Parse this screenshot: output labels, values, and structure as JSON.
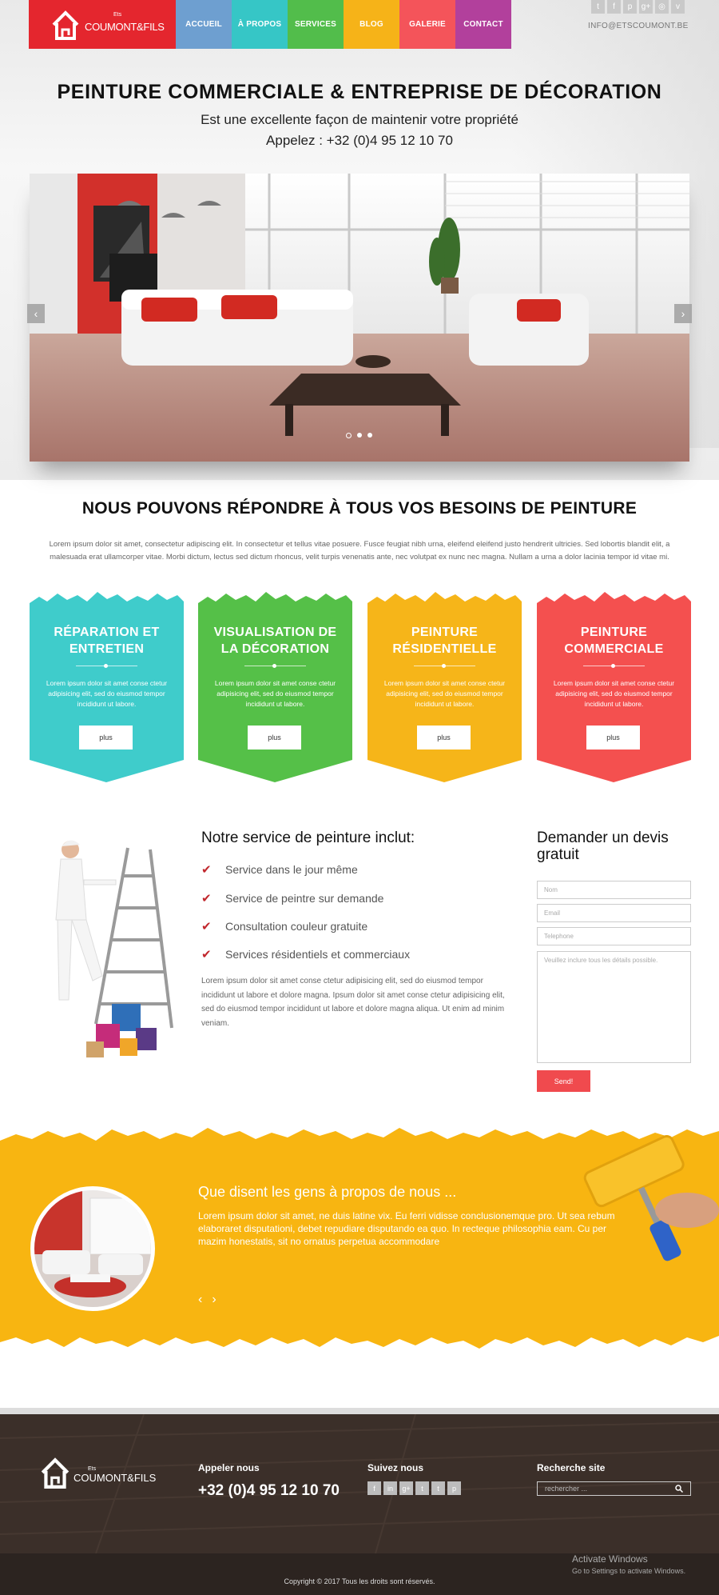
{
  "header": {
    "logo_small": "Ets",
    "logo_brand": "COUMONT&FILS",
    "nav": [
      {
        "label": "ACCUEIL",
        "color": "#6e9fd0"
      },
      {
        "label": "À PROPOS",
        "color": "#36c6c6"
      },
      {
        "label": "SERVICES",
        "color": "#52bd4b"
      },
      {
        "label": "BLOG",
        "color": "#f6b318"
      },
      {
        "label": "GALERIE",
        "color": "#f4545a"
      },
      {
        "label": "CONTACT",
        "color": "#b2409c"
      }
    ],
    "social_icons": [
      "twitter-icon",
      "facebook-icon",
      "pinterest-icon",
      "google-plus-icon",
      "instagram-icon",
      "vimeo-icon"
    ],
    "email": "INFO@ETSCOUMONT.BE"
  },
  "hero": {
    "title": "PEINTURE COMMERCIALE & ENTREPRISE DE DÉCORATION",
    "subtitle": "Est une excellente façon de maintenir votre propriété",
    "phone": "Appelez : +32 (0)4 95 12 10 70"
  },
  "slider": {
    "prev": "‹",
    "next": "›",
    "slide_count": 3,
    "active_slide": 1
  },
  "needs": {
    "title": "NOUS POUVONS RÉPONDRE À TOUS VOS BESOINS DE PEINTURE",
    "text": "Lorem ipsum dolor sit amet, consectetur adipiscing elit. In consectetur et tellus vitae posuere. Fusce feugiat nibh urna, eleifend eleifend justo hendrerit ultricies. Sed lobortis blandit elit, a malesuada erat ullamcorper vitae. Morbi dictum, lectus sed dictum rhoncus, velit turpis venenatis ante, nec volutpat ex nunc nec magna. Nullam a urna a dolor lacinia tempor id vitae mi.",
    "cards": [
      {
        "title": "RÉPARATION ET ENTRETIEN",
        "text": "Lorem ipsum dolor sit amet conse ctetur adipisicing elit, sed do eiusmod tempor incididunt ut labore.",
        "button": "plus",
        "color": "#3fcccb"
      },
      {
        "title": "VISUALISATION DE LA DÉCORATION",
        "text": "Lorem ipsum dolor sit amet conse ctetur adipisicing elit, sed do eiusmod tempor incididunt ut labore.",
        "button": "plus",
        "color": "#55c048"
      },
      {
        "title": "PEINTURE RÉSIDENTIELLE",
        "text": "Lorem ipsum dolor sit amet conse ctetur adipisicing elit, sed do eiusmod tempor incididunt ut labore.",
        "button": "plus",
        "color": "#f6b519"
      },
      {
        "title": "PEINTURE COMMERCIALE",
        "text": "Lorem ipsum dolor sit amet conse ctetur adipisicing elit, sed do eiusmod tempor incididunt ut labore.",
        "button": "plus",
        "color": "#f4504f"
      }
    ]
  },
  "services": {
    "title": "Notre service de peinture inclut:",
    "items": [
      "Service dans le jour même",
      "Service de peintre sur demande",
      "Consultation couleur gratuite",
      "Services résidentiels et commerciaux"
    ],
    "text": "Lorem ipsum dolor sit amet conse ctetur adipisicing elit, sed do eiusmod tempor incididunt ut labore et dolore magna. Ipsum dolor sit amet conse ctetur adipisicing elit, sed do eiusmod tempor incididunt ut labore et dolore magna aliqua. Ut enim ad minim veniam."
  },
  "quote_form": {
    "title": "Demander un devis gratuit",
    "name_placeholder": "Nom",
    "email_placeholder": "Email",
    "phone_placeholder": "Telephone",
    "message_placeholder": "Veuillez inclure tous les détails possible.",
    "submit": "Send!"
  },
  "testimonials": {
    "title": "Que disent les gens à propos de nous ...",
    "text": "Lorem ipsum dolor sit amet, ne duis latine vix. Eu ferri vidisse conclusionemque pro. Ut sea rebum elaboraret disputationi, debet repudiare disputando ea quo. In recteque philosophia eam. Cu per mazim honestatis, sit no ornatus perpetua accommodare",
    "prev": "‹",
    "next": "›",
    "bg_color": "#f8b511"
  },
  "footer": {
    "logo_small": "Ets",
    "logo_brand": "COUMONT&FILS",
    "call_title": "Appeler nous",
    "phone": "+32 (0)4 95 12 10 70",
    "follow_title": "Suivez nous",
    "social_icons": [
      "facebook-icon",
      "linkedin-icon",
      "google-plus-icon",
      "twitter-icon",
      "tumblr-icon",
      "pinterest-icon"
    ],
    "search_title": "Recherche site",
    "search_placeholder": "rechercher ...",
    "copyright": "Copyright © 2017 Tous les droits sont réservés."
  },
  "windows_notice": {
    "line1": "Activate Windows",
    "line2": "Go to Settings to activate Windows."
  }
}
